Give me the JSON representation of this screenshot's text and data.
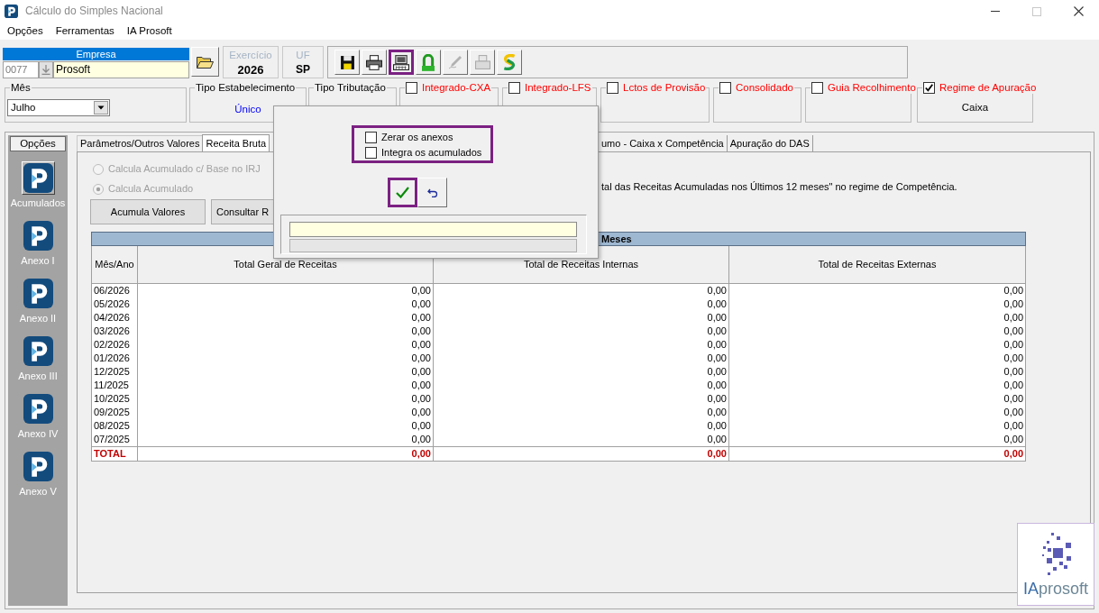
{
  "window": {
    "title": "Cálculo do Simples Nacional",
    "controls": [
      {
        "kind": "minimize",
        "disabled": false
      },
      {
        "kind": "maximize",
        "disabled": true
      },
      {
        "kind": "close",
        "disabled": false
      }
    ]
  },
  "menu": [
    "Opções",
    "Ferramentas",
    "IA Prosoft"
  ],
  "empresa": {
    "header": "Empresa",
    "code": "0077",
    "name": "Prosoft"
  },
  "exercicio": {
    "label": "Exercício",
    "value": "2026"
  },
  "uf": {
    "label": "UF",
    "value": "SP"
  },
  "toolbar": [
    {
      "kind": "save",
      "disabled": false,
      "highlighted": false
    },
    {
      "kind": "print",
      "disabled": false,
      "highlighted": false
    },
    {
      "kind": "computer",
      "disabled": false,
      "highlighted": true
    },
    {
      "kind": "padlock",
      "disabled": false,
      "highlighted": false
    },
    {
      "kind": "pen",
      "disabled": true,
      "highlighted": false
    },
    {
      "kind": "stack",
      "disabled": true,
      "highlighted": false
    },
    {
      "kind": "swirl",
      "disabled": false,
      "highlighted": false
    }
  ],
  "fields": [
    {
      "kind": "combo",
      "label": "Mês",
      "value": "Julho"
    },
    {
      "kind": "text",
      "label": "Tipo Estabelecimento",
      "value": "Único"
    },
    {
      "kind": "text",
      "label": "Tipo Tributação"
    }
  ],
  "options": [
    {
      "label": "Integrado-CXA",
      "checked": false
    },
    {
      "label": "Integrado-LFS",
      "checked": false
    },
    {
      "label": "Lctos de Provisão",
      "checked": false
    },
    {
      "label": "Consolidado",
      "checked": false
    },
    {
      "label": "Guia Recolhimento",
      "checked": false
    },
    {
      "label": "Regime de Apuração",
      "checked": true,
      "value": "Caixa"
    }
  ],
  "sidebar": {
    "header": "Opções",
    "items": [
      {
        "label": "Acumulados",
        "selected": true
      },
      {
        "label": "Anexo I",
        "selected": false
      },
      {
        "label": "Anexo II",
        "selected": false
      },
      {
        "label": "Anexo III",
        "selected": false
      },
      {
        "label": "Anexo IV",
        "selected": false
      },
      {
        "label": "Anexo V",
        "selected": false
      }
    ]
  },
  "tabs": [
    {
      "label": "Parâmetros/Outros Valores",
      "selected": false
    },
    {
      "label": "Receita Bruta",
      "selected": true
    },
    {
      "label": "umo - Caixa x Competência",
      "selected": false
    },
    {
      "label": "Apuração do DAS",
      "selected": false
    }
  ],
  "radios": [
    {
      "label": "Calcula Acumulado c/ Base no IRJ",
      "selected": false,
      "disabled": true
    },
    {
      "label": "Calcula Acumulado",
      "selected": true,
      "disabled": true
    }
  ],
  "buttons": [
    "Acumula Valores",
    "Consultar R"
  ],
  "note": "tal das Receitas Acumuladas nos Últimos 12 meses\" no regime de Competência.",
  "table": {
    "caption": "Meses",
    "columns": [
      "Mês/Ano",
      "Total Geral de Receitas",
      "Total de Receitas Internas",
      "Total de Receitas Externas"
    ],
    "rows": [
      [
        "06/2026",
        "0,00",
        "0,00",
        "0,00"
      ],
      [
        "05/2026",
        "0,00",
        "0,00",
        "0,00"
      ],
      [
        "04/2026",
        "0,00",
        "0,00",
        "0,00"
      ],
      [
        "03/2026",
        "0,00",
        "0,00",
        "0,00"
      ],
      [
        "02/2026",
        "0,00",
        "0,00",
        "0,00"
      ],
      [
        "01/2026",
        "0,00",
        "0,00",
        "0,00"
      ],
      [
        "12/2025",
        "0,00",
        "0,00",
        "0,00"
      ],
      [
        "11/2025",
        "0,00",
        "0,00",
        "0,00"
      ],
      [
        "10/2025",
        "0,00",
        "0,00",
        "0,00"
      ],
      [
        "09/2025",
        "0,00",
        "0,00",
        "0,00"
      ],
      [
        "08/2025",
        "0,00",
        "0,00",
        "0,00"
      ],
      [
        "07/2025",
        "0,00",
        "0,00",
        "0,00"
      ]
    ],
    "total": [
      "TOTAL",
      "0,00",
      "0,00",
      "0,00"
    ]
  },
  "dialog": {
    "option_group": {
      "highlighted": true,
      "items": [
        {
          "label": "Zerar os anexos",
          "checked": false
        },
        {
          "label": "Integra os acumulados",
          "checked": false
        }
      ]
    },
    "ok_button": {
      "highlighted": true
    },
    "progress": {
      "level": 0
    }
  },
  "logo": [
    "IA",
    "prosoft"
  ]
}
